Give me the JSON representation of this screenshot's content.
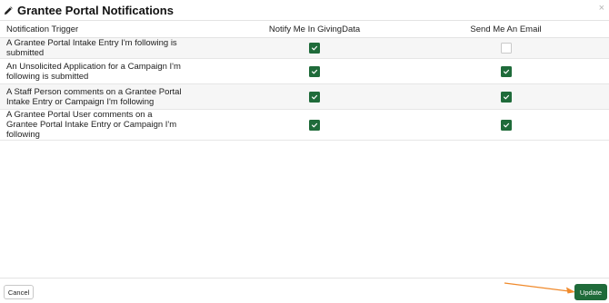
{
  "dialog": {
    "title": "Grantee Portal Notifications",
    "close_label": "×"
  },
  "table": {
    "headers": {
      "trigger": "Notification Trigger",
      "notify": "Notify Me In GivingData",
      "email": "Send Me An Email"
    },
    "rows": [
      {
        "trigger": "A Grantee Portal Intake Entry I'm following is submitted",
        "notify": true,
        "email": false
      },
      {
        "trigger": "An Unsolicited Application for a Campaign I'm following is submitted",
        "notify": true,
        "email": true
      },
      {
        "trigger": "A Staff Person comments on a Grantee Portal Intake Entry or Campaign I'm following",
        "notify": true,
        "email": true
      },
      {
        "trigger": "A Grantee Portal User comments on a Grantee Portal Intake Entry or Campaign I'm following",
        "notify": true,
        "email": true
      }
    ]
  },
  "footer": {
    "cancel_label": "Cancel",
    "update_label": "Update"
  },
  "colors": {
    "accent": "#1f6b3a",
    "annotation_arrow": "#f08a2c"
  }
}
